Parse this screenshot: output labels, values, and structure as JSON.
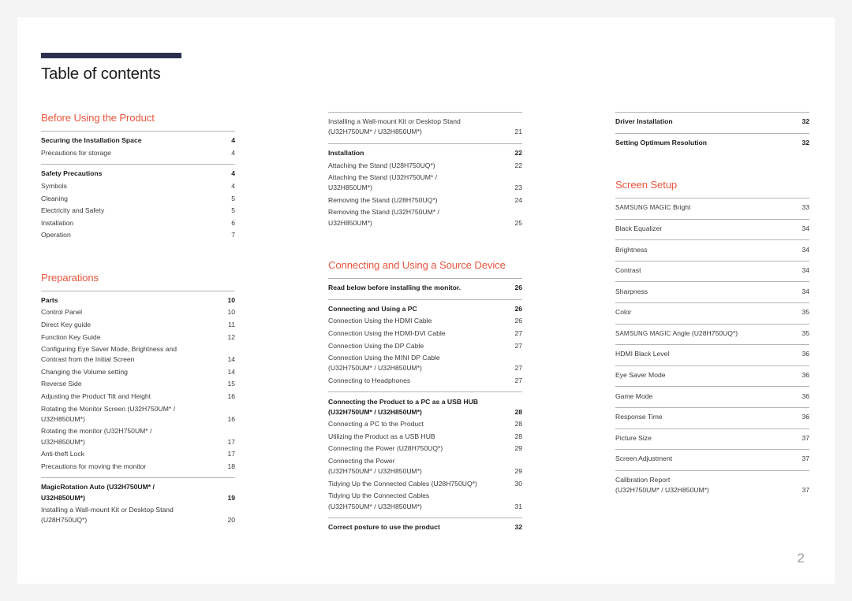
{
  "document": {
    "title": "Table of contents",
    "page_number": "2",
    "accent_color": "#e8573f",
    "rule_color": "#2b3050"
  },
  "columns": [
    {
      "blocks": [
        {
          "type": "section",
          "heading": "Before Using the Product",
          "groups": [
            {
              "entries": [
                {
                  "label": "Securing the Installation Space",
                  "page": "4",
                  "bold": true
                },
                {
                  "label": "Precautions for storage",
                  "page": "4",
                  "bold": false
                }
              ]
            },
            {
              "entries": [
                {
                  "label": "Safety Precautions",
                  "page": "4",
                  "bold": true
                },
                {
                  "label": "Symbols",
                  "page": "4",
                  "bold": false
                },
                {
                  "label": "Cleaning",
                  "page": "5",
                  "bold": false
                },
                {
                  "label": "Electricity and Safety",
                  "page": "5",
                  "bold": false
                },
                {
                  "label": "Installation",
                  "page": "6",
                  "bold": false
                },
                {
                  "label": "Operation",
                  "page": "7",
                  "bold": false
                }
              ]
            }
          ]
        },
        {
          "type": "section",
          "heading": "Preparations",
          "groups": [
            {
              "entries": [
                {
                  "label": "Parts",
                  "page": "10",
                  "bold": true
                },
                {
                  "label": "Control Panel",
                  "page": "10",
                  "bold": false
                },
                {
                  "label": "Direct Key guide",
                  "page": "11",
                  "bold": false
                },
                {
                  "label": "Function Key Guide",
                  "page": "12",
                  "bold": false
                },
                {
                  "label": "Configuring Eye Saver Mode, Brightness and\nContrast from the Initial Screen",
                  "page": "14",
                  "bold": false,
                  "multiline": true
                },
                {
                  "label": "Changing the Volume setting",
                  "page": "14",
                  "bold": false
                },
                {
                  "label": "Reverse Side",
                  "page": "15",
                  "bold": false
                },
                {
                  "label": "Adjusting the Product Tilt and Height",
                  "page": "16",
                  "bold": false
                },
                {
                  "label": "Rotating the Monitor Screen (U32H750UM* /\nU32H850UM*)",
                  "page": "16",
                  "bold": false,
                  "multiline": true
                },
                {
                  "label": "Rotating the monitor (U32H750UM* /\nU32H850UM*)",
                  "page": "17",
                  "bold": false,
                  "multiline": true
                },
                {
                  "label": "Anti-theft Lock",
                  "page": "17",
                  "bold": false
                },
                {
                  "label": "Precautions for moving the monitor",
                  "page": "18",
                  "bold": false
                }
              ]
            },
            {
              "entries": [
                {
                  "label": "MagicRotation Auto (U32H750UM* /\nU32H850UM*)",
                  "page": "19",
                  "bold": true,
                  "multiline": true
                },
                {
                  "label": "Installing a Wall-mount Kit or Desktop Stand\n(U28H750UQ*)",
                  "page": "20",
                  "bold": false,
                  "multiline": true
                }
              ]
            }
          ]
        }
      ]
    },
    {
      "blocks": [
        {
          "type": "continuation",
          "heading": "",
          "groups": [
            {
              "entries": [
                {
                  "label": "Installing a Wall-mount Kit or Desktop Stand\n(U32H750UM* / U32H850UM*)",
                  "page": "21",
                  "bold": false,
                  "multiline": true
                }
              ]
            },
            {
              "entries": [
                {
                  "label": "Installation",
                  "page": "22",
                  "bold": true
                },
                {
                  "label": "Attaching the Stand (U28H750UQ*)",
                  "page": "22",
                  "bold": false
                },
                {
                  "label": "Attaching the Stand (U32H750UM* /\nU32H850UM*)",
                  "page": "23",
                  "bold": false,
                  "multiline": true
                },
                {
                  "label": "Removing the Stand (U28H750UQ*)",
                  "page": "24",
                  "bold": false
                },
                {
                  "label": "Removing the Stand (U32H750UM* /\nU32H850UM*)",
                  "page": "25",
                  "bold": false,
                  "multiline": true
                }
              ]
            }
          ]
        },
        {
          "type": "section",
          "heading": "Connecting and Using a Source Device",
          "groups": [
            {
              "entries": [
                {
                  "label": "Read below before installing the monitor.",
                  "page": "26",
                  "bold": true
                }
              ]
            },
            {
              "entries": [
                {
                  "label": "Connecting and Using a PC",
                  "page": "26",
                  "bold": true
                },
                {
                  "label": "Connection Using the HDMI Cable",
                  "page": "26",
                  "bold": false
                },
                {
                  "label": "Connection Using the HDMI-DVI Cable",
                  "page": "27",
                  "bold": false
                },
                {
                  "label": "Connection Using the DP Cable",
                  "page": "27",
                  "bold": false
                },
                {
                  "label": "Connection Using the MINI DP Cable\n(U32H750UM* / U32H850UM*)",
                  "page": "27",
                  "bold": false,
                  "multiline": true
                },
                {
                  "label": "Connecting to Headphones",
                  "page": "27",
                  "bold": false
                }
              ]
            },
            {
              "entries": [
                {
                  "label": "Connecting the Product to a PC as a USB HUB\n(U32H750UM* / U32H850UM*)",
                  "page": "28",
                  "bold": true,
                  "multiline": true
                },
                {
                  "label": "Connecting a PC to the Product",
                  "page": "28",
                  "bold": false
                },
                {
                  "label": "Utilizing the Product as a USB HUB",
                  "page": "28",
                  "bold": false
                },
                {
                  "label": "Connecting the Power (U28H750UQ*)",
                  "page": "29",
                  "bold": false
                },
                {
                  "label": "Connecting the Power\n(U32H750UM* / U32H850UM*)",
                  "page": "29",
                  "bold": false,
                  "multiline": true
                },
                {
                  "label": "Tidying Up the Connected Cables (U28H750UQ*)",
                  "page": "30",
                  "bold": false
                },
                {
                  "label": "Tidying Up the Connected Cables\n(U32H750UM* / U32H850UM*)",
                  "page": "31",
                  "bold": false,
                  "multiline": true
                }
              ]
            },
            {
              "entries": [
                {
                  "label": "Correct posture to use the product",
                  "page": "32",
                  "bold": true
                }
              ]
            }
          ]
        }
      ]
    },
    {
      "blocks": [
        {
          "type": "continuation",
          "heading": "",
          "groups": [
            {
              "entries": [
                {
                  "label": "Driver Installation",
                  "page": "32",
                  "bold": true
                }
              ]
            },
            {
              "entries": [
                {
                  "label": "Setting Optimum Resolution",
                  "page": "32",
                  "bold": true
                }
              ]
            }
          ]
        },
        {
          "type": "section",
          "heading": "Screen Setup",
          "groups": [
            {
              "entries": [
                {
                  "label": "SAMSUNG MAGIC Bright",
                  "page": "33",
                  "bold": false,
                  "smallcaps_prefix": "SAMSUNG MAGIC"
                }
              ]
            },
            {
              "entries": [
                {
                  "label": "Black Equalizer",
                  "page": "34",
                  "bold": false
                }
              ]
            },
            {
              "entries": [
                {
                  "label": "Brightness",
                  "page": "34",
                  "bold": false
                }
              ]
            },
            {
              "entries": [
                {
                  "label": "Contrast",
                  "page": "34",
                  "bold": false
                }
              ]
            },
            {
              "entries": [
                {
                  "label": "Sharpness",
                  "page": "34",
                  "bold": false
                }
              ]
            },
            {
              "entries": [
                {
                  "label": "Color",
                  "page": "35",
                  "bold": false
                }
              ]
            },
            {
              "entries": [
                {
                  "label": "SAMSUNG MAGIC Angle (U28H750UQ*)",
                  "page": "35",
                  "bold": false,
                  "smallcaps_prefix": "SAMSUNG MAGIC"
                }
              ]
            },
            {
              "entries": [
                {
                  "label": "HDMI Black Level",
                  "page": "36",
                  "bold": false
                }
              ]
            },
            {
              "entries": [
                {
                  "label": "Eye Saver Mode",
                  "page": "36",
                  "bold": false
                }
              ]
            },
            {
              "entries": [
                {
                  "label": "Game Mode",
                  "page": "36",
                  "bold": false
                }
              ]
            },
            {
              "entries": [
                {
                  "label": "Response Time",
                  "page": "36",
                  "bold": false
                }
              ]
            },
            {
              "entries": [
                {
                  "label": "Picture Size",
                  "page": "37",
                  "bold": false
                }
              ]
            },
            {
              "entries": [
                {
                  "label": "Screen Adjustment",
                  "page": "37",
                  "bold": false
                }
              ]
            },
            {
              "entries": [
                {
                  "label": "Calibration Report\n(U32H750UM* / U32H850UM*)",
                  "page": "37",
                  "bold": false,
                  "multiline": true
                }
              ]
            }
          ]
        }
      ]
    }
  ]
}
